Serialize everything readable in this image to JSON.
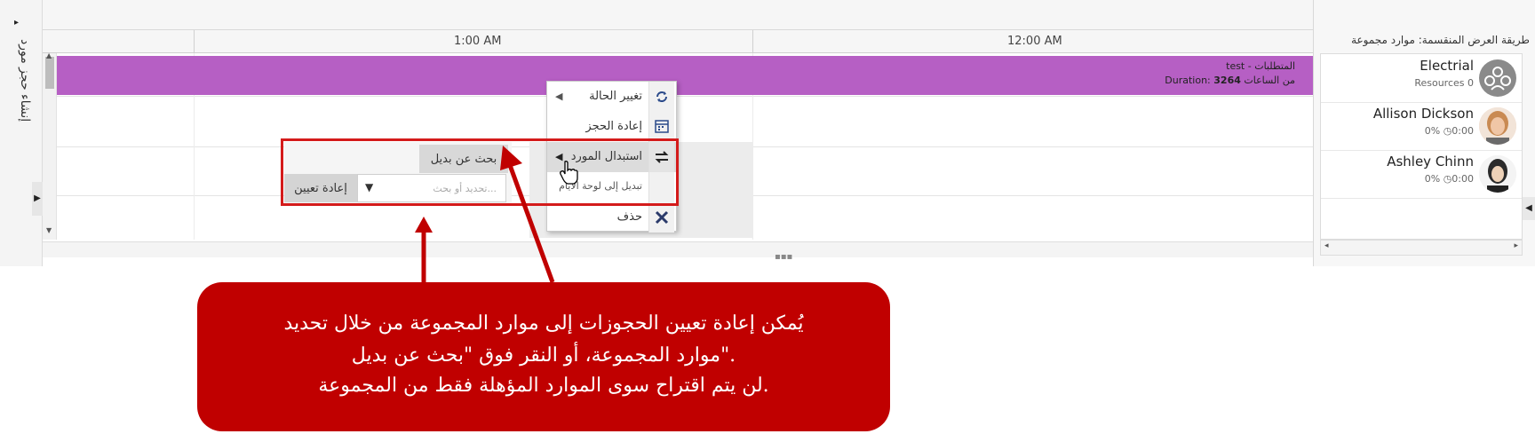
{
  "left_panel": {
    "label": "إنشاء حجز مورد",
    "toggle_icon": "caret-right-icon"
  },
  "timeline": {
    "labels": [
      "1:00 AM",
      "12:00 AM"
    ]
  },
  "booking": {
    "title": "test - المتطلبات",
    "duration_value": "3264",
    "duration_text": "Duration: ",
    "duration_suffix": " من الساعات",
    "color": "#b65fc4"
  },
  "resources": {
    "split_view_label": "طريقة العرض المنقسمة: موارد مجموعة",
    "items": [
      {
        "name": "Electrial",
        "sub": "Resources 0",
        "avatar": "group-avatar-icon"
      },
      {
        "name": "Allison Dickson",
        "sub": "0%  ◷0:00",
        "avatar": "person-avatar"
      },
      {
        "name": "Ashley Chinn",
        "sub": "0%  ◷0:00",
        "avatar": "person-avatar"
      }
    ]
  },
  "context_menu": {
    "items": [
      {
        "label": "تغيير الحالة",
        "icon": "refresh-icon",
        "has_submenu": true
      },
      {
        "label": "إعادة الحجز",
        "icon": "calendar-icon",
        "has_submenu": false
      },
      {
        "label": "استبدال المورد",
        "icon": "swap-icon",
        "has_submenu": true
      },
      {
        "label": "تبديل إلى لوحة الأيام",
        "icon": "",
        "has_submenu": false
      },
      {
        "label": "حذف",
        "icon": "close-icon",
        "has_submenu": false
      }
    ]
  },
  "submenu": {
    "find_alternative": "بحث عن بديل",
    "search_placeholder": "تحديد أو بحث...",
    "reassign": "إعادة تعيين"
  },
  "callout": {
    "lines": [
      "يُمكن إعادة تعيين الحجوزات إلى موارد المجموعة من خلال تحديد",
      "موارد المجموعة، أو النقر فوق \"بحث عن بديل\".",
      "لن يتم اقتراح سوى الموارد المؤهلة فقط من المجموعة."
    ],
    "color": "#c00000"
  },
  "colors": {
    "highlight": "#d41b1b",
    "accent_purple": "#b65fc4"
  }
}
